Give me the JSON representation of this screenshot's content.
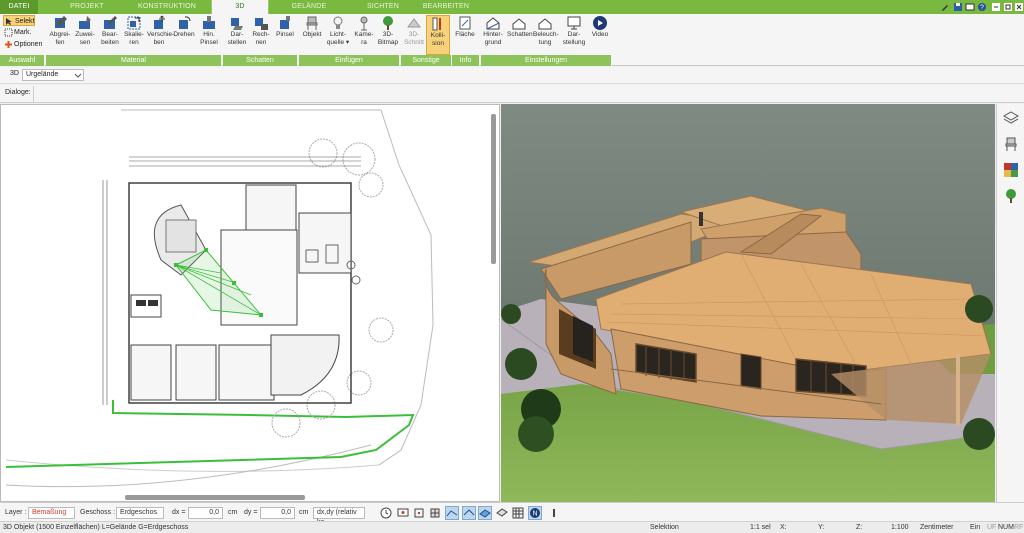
{
  "tabs": [
    {
      "label": "DATEI"
    },
    {
      "label": "PROJEKT"
    },
    {
      "label": "KONSTRUKTION"
    },
    {
      "label": "3D"
    },
    {
      "label": "GELÄNDE"
    },
    {
      "label": "SICHTEN"
    },
    {
      "label": "BEARBEITEN"
    }
  ],
  "auswahl": {
    "items": [
      {
        "label": "Selekt"
      },
      {
        "label": "Mark."
      },
      {
        "label": "Optionen"
      }
    ],
    "group": "Auswahl"
  },
  "groups": {
    "material": "Material",
    "schatten": "Schatten",
    "einfuegen": "Einfügen",
    "sonstige": "Sonstige",
    "info": "Info",
    "einstellungen": "Einstellungen"
  },
  "tools": {
    "abgreifen": "Abgrei-\nfen",
    "zuweisen": "Zuwei-\nsen",
    "bearbeiten": "Bear-\nbeiten",
    "skalieren": "Skalie-\nren",
    "verschieben": "Verschie-\nben",
    "drehen": "Drehen",
    "hinpinsel": "Hin.\nPinsel",
    "darstellen": "Dar-\nstellen",
    "rechnen": "Rech-\nnen",
    "pinsel": "Pinsel",
    "objekt": "Objekt",
    "lichtquelle": "Licht-\nquelle ▾",
    "kamera": "Kame-\nra",
    "bitmap": "3D-\nBitmap",
    "schnitt": "3D-\nSchnitt",
    "kollision": "Kolli-\nsion",
    "flaeche": "Fläche",
    "hintergrund": "Hinter-\ngrund",
    "schatten": "Schatten",
    "beleuchtung": "Beleuch-\ntung",
    "darstellung": "Dar-\nstellung",
    "video": "Video"
  },
  "bar1": {
    "view": "3D",
    "terrain": "Urgelände"
  },
  "bar2": {
    "dialoge": "Dialoge:"
  },
  "bottom": {
    "layer_label": "Layer :",
    "layer_value": "Bemaßung",
    "geschoss_label": "Geschoss :",
    "geschoss_value": "Erdgeschos",
    "dx_label": "dx =",
    "dx_value": "0,0",
    "unit1": "cm",
    "dy_label": "dy =",
    "dy_value": "0,0",
    "unit2": "cm",
    "mode": "dx,dy (relativ ka"
  },
  "status": {
    "info": "3D Objekt (1500 Einzelflächen) L=Gelände G=Erdgeschoss",
    "mode": "Selektion",
    "scale": "1:1 sel",
    "x": "X:",
    "y": "Y:",
    "z": "Z:",
    "ratio": "1:100",
    "unit": "Zentimeter",
    "ein": "Ein",
    "uf": "UF",
    "num": "NUM",
    "rf": "RF"
  },
  "colors": {
    "ribbon_green": "#79b93f",
    "group_green": "#8dc35a",
    "selected": "#f7d27a"
  }
}
